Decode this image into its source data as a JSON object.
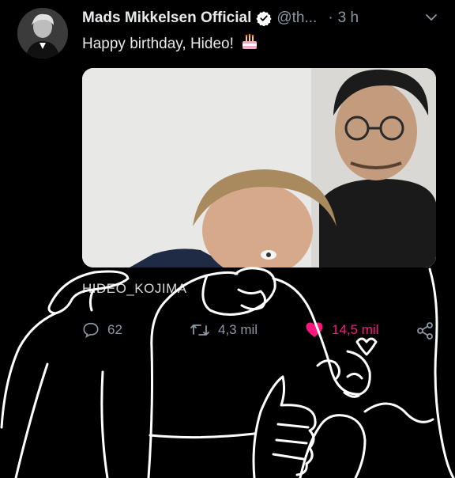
{
  "tweet": {
    "display_name": "Mads Mikkelsen Official",
    "handle": "@th...",
    "separator": "·",
    "time": "3 h",
    "text": "Happy birthday, Hideo!",
    "photo_tag": "HIDEO_KOJIMA"
  },
  "actions": {
    "replies": "62",
    "retweets": "4,3 mil",
    "likes": "14,5 mil"
  },
  "icons": {
    "verified": "verified-badge-icon",
    "caret": "chevron-down-icon",
    "cake": "birthday-cake-emoji",
    "reply": "reply-icon",
    "retweet": "retweet-icon",
    "like": "heart-icon",
    "share": "share-icon"
  },
  "colors": {
    "background": "#000000",
    "like_active": "#f91880",
    "muted": "#8b98a5",
    "verified_badge": "#ffffff",
    "doodle_stroke": "#ffffff"
  }
}
